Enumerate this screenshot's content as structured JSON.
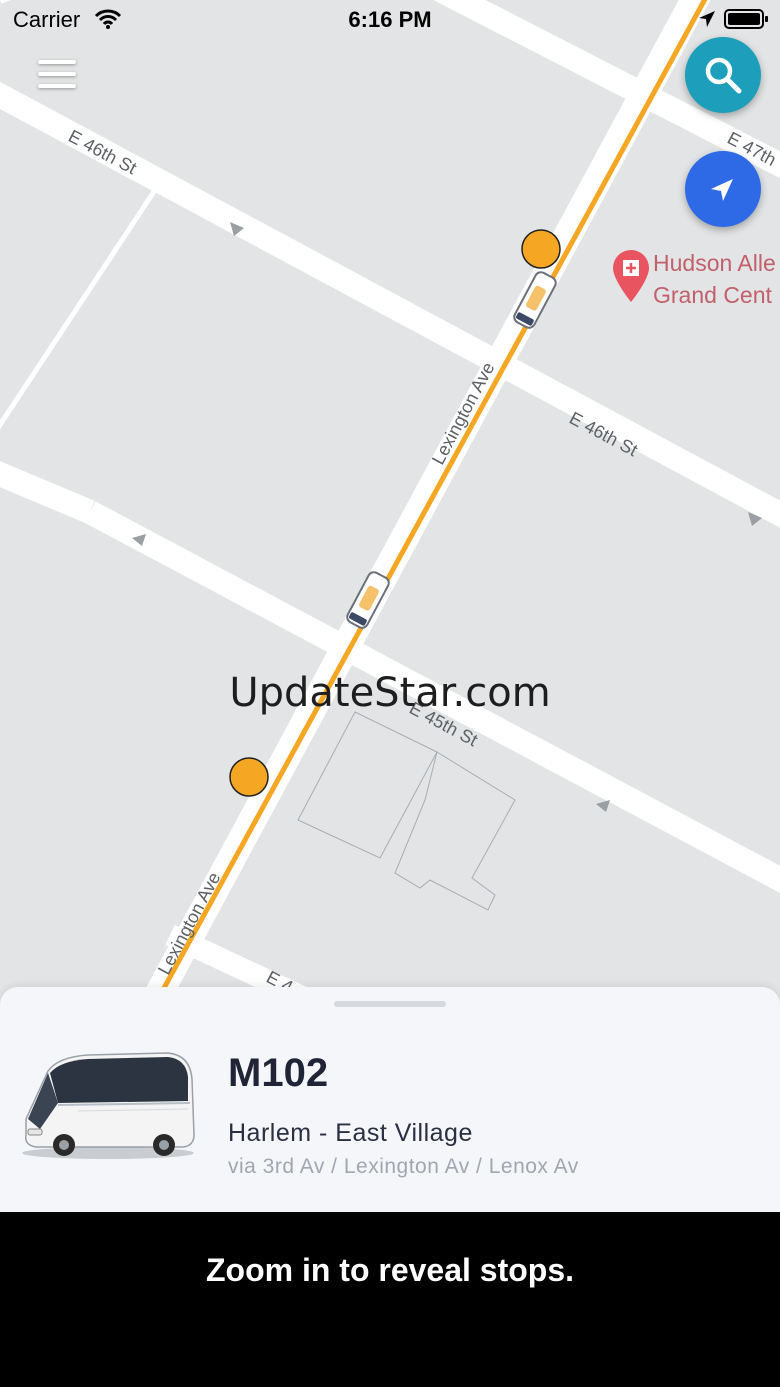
{
  "status_bar": {
    "carrier": "Carrier",
    "time": "6:16 PM",
    "icons": [
      "wifi-icon",
      "location-arrow-icon",
      "battery-icon"
    ]
  },
  "map": {
    "street_labels": {
      "e46_upper": "E 46th St",
      "e46_lower": "E 46th St",
      "e47": "E 47th",
      "lexington_upper": "Lexington Ave",
      "lexington_lower": "Lexington Ave",
      "e45": "E 45th St",
      "e44_partial": "E 4"
    },
    "poi": {
      "icon": "hospital-pin-icon",
      "line1": "Hudson Alle",
      "line2": "Grand Cent"
    },
    "route_color": "#f5a623",
    "stop_color": "#f5a623"
  },
  "controls": {
    "menu_icon": "hamburger-menu-icon",
    "search_icon": "search-icon",
    "locate_icon": "navigation-arrow-icon",
    "search_color": "#1d9fbb",
    "locate_color": "#2f6ae6"
  },
  "watermark": "UpdateStar.com",
  "route": {
    "number": "M102",
    "name": "Harlem - East Village",
    "via": "via 3rd Av / Lexington Av / Lenox Av",
    "image": "bus-image"
  },
  "footer": {
    "message": "Zoom in to reveal stops."
  }
}
